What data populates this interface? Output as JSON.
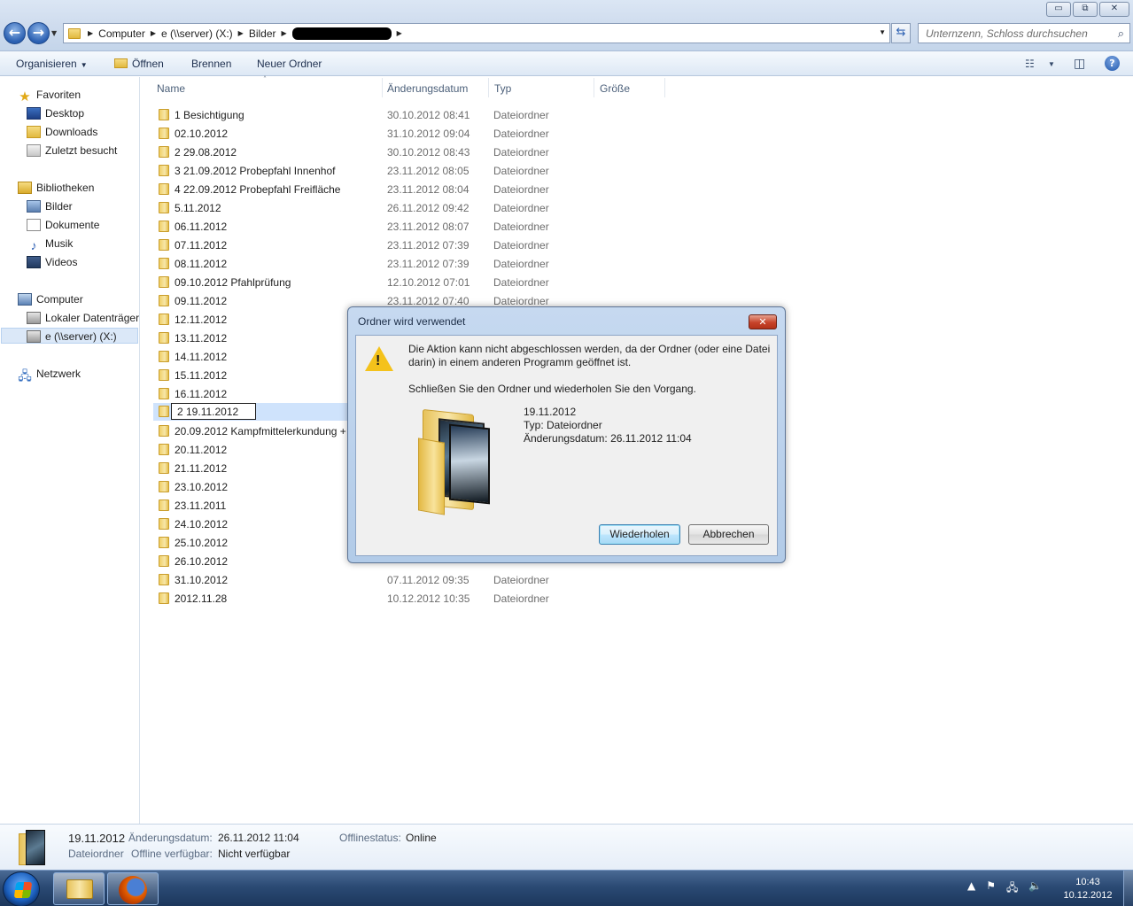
{
  "window": {
    "buttons": {
      "minimize": "▭",
      "maximize": "⧉",
      "close": "✕"
    }
  },
  "address": {
    "crumbs": [
      "Computer",
      "e (\\\\server) (X:)",
      "Bilder"
    ],
    "redacted": ""
  },
  "search": {
    "placeholder": "Unternzenn, Schloss durchsuchen"
  },
  "toolbar": {
    "organize": "Organisieren",
    "open": "Öffnen",
    "burn": "Brennen",
    "new_folder": "Neuer Ordner",
    "help": "?"
  },
  "nav": {
    "favorites": "Favoriten",
    "desktop": "Desktop",
    "downloads": "Downloads",
    "recent": "Zuletzt besucht",
    "libraries": "Bibliotheken",
    "pictures": "Bilder",
    "documents": "Dokumente",
    "music": "Musik",
    "videos": "Videos",
    "computer": "Computer",
    "local_disk": "Lokaler Datenträger",
    "server_drive": "e (\\\\server) (X:)",
    "network": "Netzwerk"
  },
  "columns": {
    "name": "Name",
    "date": "Änderungsdatum",
    "type": "Typ",
    "size": "Größe"
  },
  "files": [
    {
      "name": "1  Besichtigung",
      "date": "30.10.2012 08:41",
      "type": "Dateiordner"
    },
    {
      "name": "02.10.2012",
      "date": "31.10.2012 09:04",
      "type": "Dateiordner"
    },
    {
      "name": "2  29.08.2012",
      "date": "30.10.2012 08:43",
      "type": "Dateiordner"
    },
    {
      "name": "3  21.09.2012 Probepfahl Innenhof",
      "date": "23.11.2012 08:05",
      "type": "Dateiordner"
    },
    {
      "name": "4  22.09.2012 Probepfahl Freifläche",
      "date": "23.11.2012 08:04",
      "type": "Dateiordner"
    },
    {
      "name": "5.11.2012",
      "date": "26.11.2012 09:42",
      "type": "Dateiordner"
    },
    {
      "name": "06.11.2012",
      "date": "23.11.2012 08:07",
      "type": "Dateiordner"
    },
    {
      "name": "07.11.2012",
      "date": "23.11.2012 07:39",
      "type": "Dateiordner"
    },
    {
      "name": "08.11.2012",
      "date": "23.11.2012 07:39",
      "type": "Dateiordner"
    },
    {
      "name": "09.10.2012 Pfahlprüfung",
      "date": "12.10.2012 07:01",
      "type": "Dateiordner"
    },
    {
      "name": "09.11.2012",
      "date": "23.11.2012 07:40",
      "type": "Dateiordner"
    },
    {
      "name": "12.11.2012",
      "date": "",
      "type": ""
    },
    {
      "name": "13.11.2012",
      "date": "",
      "type": ""
    },
    {
      "name": "14.11.2012",
      "date": "",
      "type": ""
    },
    {
      "name": "15.11.2012",
      "date": "",
      "type": ""
    },
    {
      "name": "16.11.2012",
      "date": "",
      "type": ""
    },
    {
      "name": "2 19.11.2012",
      "date": "",
      "type": ""
    },
    {
      "name": "20.09.2012 Kampfmittelerkundung +",
      "date": "",
      "type": ""
    },
    {
      "name": "20.11.2012",
      "date": "",
      "type": ""
    },
    {
      "name": "21.11.2012",
      "date": "",
      "type": ""
    },
    {
      "name": "23.10.2012",
      "date": "",
      "type": ""
    },
    {
      "name": "23.11.2011",
      "date": "",
      "type": ""
    },
    {
      "name": "24.10.2012",
      "date": "",
      "type": ""
    },
    {
      "name": "25.10.2012",
      "date": "",
      "type": ""
    },
    {
      "name": "26.10.2012",
      "date": "",
      "type": ""
    },
    {
      "name": "31.10.2012",
      "date": "07.11.2012 09:35",
      "type": "Dateiordner"
    },
    {
      "name": "2012.11.28",
      "date": "10.12.2012 10:35",
      "type": "Dateiordner"
    }
  ],
  "dialog": {
    "title": "Ordner wird verwendet",
    "close": "✕",
    "message_line1": "Die Aktion kann nicht abgeschlossen werden, da der Ordner (oder eine Datei",
    "message_line2": "darin) in einem anderen Programm geöffnet ist.",
    "message2": "Schließen Sie den Ordner und wiederholen Sie den Vorgang.",
    "item_name": "19.11.2012",
    "item_type": "Typ: Dateiordner",
    "item_date": "Änderungsdatum: 26.11.2012 11:04",
    "retry": "Wiederholen",
    "cancel": "Abbrechen",
    "warn": "!"
  },
  "details": {
    "name": "19.11.2012",
    "date_label": "Änderungsdatum:",
    "date_value": "26.11.2012 11:04",
    "kind": "Dateiordner",
    "offline_avail_label": "Offline verfügbar:",
    "offline_avail_value": "Nicht verfügbar",
    "offline_status_label": "Offlinestatus:",
    "offline_status_value": "Online"
  },
  "taskbar": {
    "time": "10:43",
    "date": "10.12.2012"
  }
}
